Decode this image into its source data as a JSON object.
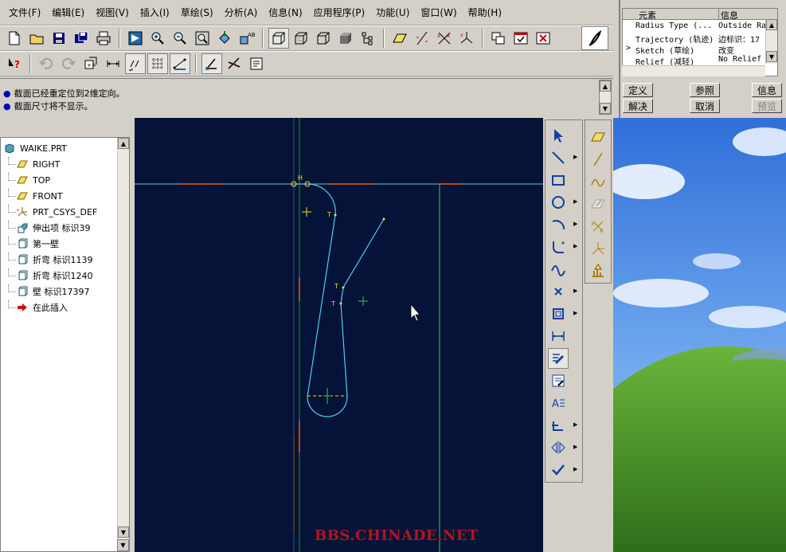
{
  "menu": [
    "文件(F)",
    "编辑(E)",
    "视图(V)",
    "插入(I)",
    "草绘(S)",
    "分析(A)",
    "信息(N)",
    "应用程序(P)",
    "功能(U)",
    "窗口(W)",
    "帮助(H)"
  ],
  "messages": [
    "截面已经重定位到2维定向。",
    "截面尺寸将不显示。"
  ],
  "model_tree": {
    "root": "WAIKE.PRT",
    "items": [
      {
        "label": "RIGHT",
        "icon": "datum-plane-icon"
      },
      {
        "label": "TOP",
        "icon": "datum-plane-icon"
      },
      {
        "label": "FRONT",
        "icon": "datum-plane-icon"
      },
      {
        "label": "PRT_CSYS_DEF",
        "icon": "csys-icon"
      },
      {
        "label": "伸出项 标识39",
        "icon": "protrusion-icon"
      },
      {
        "label": "第一壁",
        "icon": "wall-icon"
      },
      {
        "label": "折弯 标识1139",
        "icon": "wall-icon"
      },
      {
        "label": "折弯 标识1240",
        "icon": "wall-icon"
      },
      {
        "label": "壁 标识17397",
        "icon": "wall-icon"
      },
      {
        "label": "在此插入",
        "icon": "insert-arrow-icon"
      }
    ]
  },
  "dialog": {
    "col_element": "元素",
    "col_info": "信息",
    "rows": [
      {
        "marker": "",
        "element": "Radius Type (...",
        "info": "Outside Ra"
      },
      {
        "marker": "",
        "element": "Trajectory (轨迹)",
        "info": "边标识：17"
      },
      {
        "marker": ">",
        "element": "Sketch (草绘)",
        "info": "改变"
      },
      {
        "marker": "",
        "element": "Relief (减轻)",
        "info": "No Relief"
      }
    ],
    "buttons": {
      "define": "定义",
      "refs": "参照",
      "info": "信息",
      "resolve": "解决",
      "cancel": "取消",
      "preview": "预览"
    }
  },
  "watermark": "BBS.CHINADE.NET",
  "colors": {
    "canvas_bg": "#041337",
    "sketch_line": "#4fd0f0",
    "axis_line": "#70b8d8",
    "reference_line": "#3ec845",
    "constraint_marker": "#f0e020",
    "dialog_bg": "#d4d0c8"
  }
}
